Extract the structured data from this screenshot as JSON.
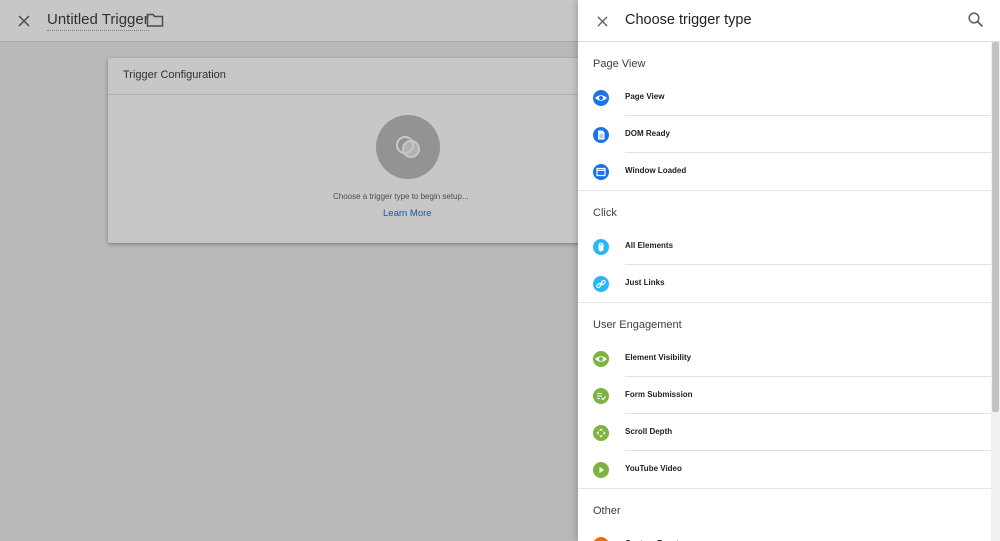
{
  "editor": {
    "title": "Untitled Trigger",
    "card_title": "Trigger Configuration",
    "hint": "Choose a trigger type to begin setup...",
    "learn_more": "Learn More"
  },
  "panel": {
    "title": "Choose trigger type",
    "sections": [
      {
        "heading": "Page View",
        "items": [
          {
            "label": "Page View",
            "icon": "eye-icon",
            "color": "#1a73e8"
          },
          {
            "label": "DOM Ready",
            "icon": "document-icon",
            "color": "#1a73e8"
          },
          {
            "label": "Window Loaded",
            "icon": "window-icon",
            "color": "#1a73e8"
          }
        ]
      },
      {
        "heading": "Click",
        "items": [
          {
            "label": "All Elements",
            "icon": "mouse-icon",
            "color": "#29b6f6"
          },
          {
            "label": "Just Links",
            "icon": "link-icon",
            "color": "#29b6f6"
          }
        ]
      },
      {
        "heading": "User Engagement",
        "items": [
          {
            "label": "Element Visibility",
            "icon": "eye-icon",
            "color": "#7cb342"
          },
          {
            "label": "Form Submission",
            "icon": "form-icon",
            "color": "#7cb342"
          },
          {
            "label": "Scroll Depth",
            "icon": "scroll-icon",
            "color": "#7cb342"
          },
          {
            "label": "YouTube Video",
            "icon": "play-icon",
            "color": "#7cb342"
          }
        ]
      },
      {
        "heading": "Other",
        "items": [
          {
            "label": "Custom Event",
            "icon": "custom-event-icon",
            "color": "#ef6c00"
          }
        ]
      }
    ]
  }
}
